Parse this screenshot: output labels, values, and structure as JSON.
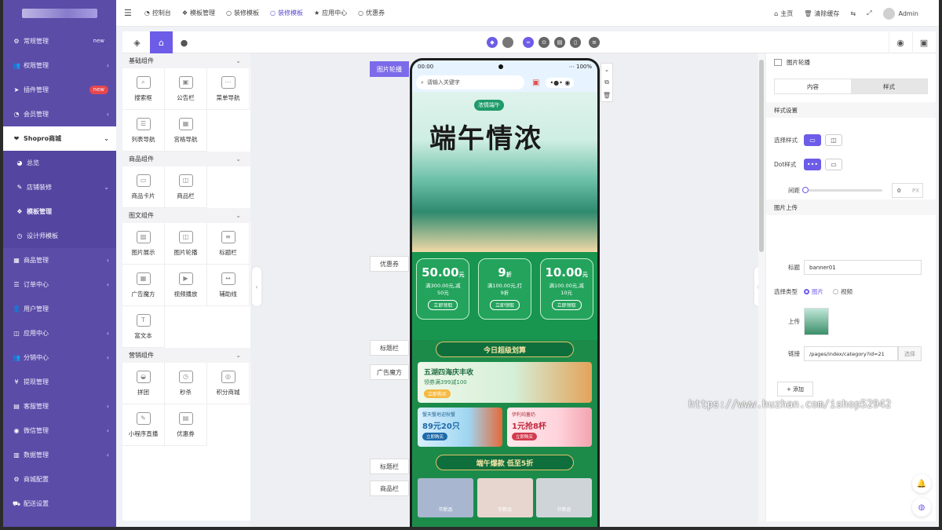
{
  "topbar": {
    "items": [
      {
        "icon": "dashboard-icon",
        "glyph": "◔",
        "label": "控制台"
      },
      {
        "icon": "cubes-icon",
        "glyph": "❖",
        "label": "模板管理"
      },
      {
        "icon": "circle-icon",
        "glyph": "○",
        "label": "装修模板"
      },
      {
        "icon": "circle-icon",
        "glyph": "○",
        "label": "装修模板"
      },
      {
        "icon": "star-icon",
        "glyph": "★",
        "label": "应用中心"
      },
      {
        "icon": "circle-icon",
        "glyph": "○",
        "label": "优惠券"
      }
    ],
    "active_index": 3,
    "right": {
      "home": "主页",
      "clear_cache": "清除缓存",
      "user": "Admin"
    }
  },
  "sidebar": {
    "items": [
      {
        "label": "常规管理",
        "badge": "new",
        "badge_color": "#5b4ca8"
      },
      {
        "label": "权限管理",
        "arrow": "‹"
      },
      {
        "label": "插件管理",
        "badge": "new",
        "badge_color": "#e5484d"
      },
      {
        "label": "会员管理",
        "arrow": "‹"
      },
      {
        "label": "Shopro商城",
        "arrow": "⌄",
        "active": true
      },
      {
        "label": "总览",
        "sub": true
      },
      {
        "label": "店铺装修",
        "arrow": "⌄",
        "sub": true
      },
      {
        "label": "模板管理",
        "sub": true,
        "bold": true
      },
      {
        "label": "设计师模板",
        "sub": true
      },
      {
        "label": "商品管理",
        "arrow": "‹"
      },
      {
        "label": "订单中心",
        "arrow": "‹"
      },
      {
        "label": "用户管理"
      },
      {
        "label": "应用中心",
        "arrow": "‹"
      },
      {
        "label": "分销中心",
        "arrow": "‹"
      },
      {
        "label": "提现管理"
      },
      {
        "label": "客服管理",
        "arrow": "‹"
      },
      {
        "label": "微信管理",
        "arrow": "‹"
      },
      {
        "label": "数据管理",
        "arrow": "‹"
      },
      {
        "label": "商城配置"
      },
      {
        "label": "配送设置"
      }
    ]
  },
  "components": {
    "groups": [
      {
        "title": "基础组件",
        "items": [
          "搜索框",
          "公告栏",
          "菜单导航",
          "列表导航",
          "宫格导航"
        ]
      },
      {
        "title": "商品组件",
        "items": [
          "商品卡片",
          "商品栏"
        ]
      },
      {
        "title": "图文组件",
        "items": [
          "图片展示",
          "图片轮播",
          "标题栏",
          "广告魔方",
          "视频播放",
          "辅助线",
          "富文本"
        ]
      },
      {
        "title": "营销组件",
        "items": [
          "拼团",
          "秒杀",
          "积分商城",
          "小程序直播",
          "优惠券"
        ]
      }
    ]
  },
  "canvas": {
    "chips": {
      "banner": "图片轮播",
      "coupon": "优惠券",
      "title1": "标题栏",
      "ad": "广告魔方",
      "title2": "标题栏",
      "goods": "商品栏"
    },
    "phone": {
      "time": "00:00",
      "battery": "100%",
      "search_placeholder": "请输入关键字",
      "banner_title": "端午情浓",
      "banner_seal": "浓情端午",
      "coupons": [
        {
          "value": "50.00",
          "unit": "元",
          "desc": "满300.00元,减",
          "desc2": "50元",
          "btn": "立即领取"
        },
        {
          "value": "9",
          "unit": "折",
          "desc": "满100.00元,打",
          "desc2": "9折",
          "btn": "立即领取"
        },
        {
          "value": "10.00",
          "unit": "元",
          "desc": "满100.00元,减",
          "desc2": "10元",
          "btn": "立即领取"
        }
      ],
      "ribbon1": "今日超级划算",
      "promo": {
        "title": "五湖四海庆丰收",
        "sub": "领券满399减100",
        "btn": "立即购买"
      },
      "duo": [
        {
          "sub": "蟹天蟹地迎秋蟹",
          "price": "89元20只",
          "btn": "立即购买"
        },
        {
          "sub": "伊利纯蓄奶",
          "price": "1元抢8杯",
          "btn": "立即购买"
        }
      ],
      "ribbon2": "端午爆款 低至5折",
      "prods": [
        "节新品",
        "节新品",
        "节新品"
      ]
    }
  },
  "props": {
    "header": "图片轮播",
    "tabs": [
      "内容",
      "样式"
    ],
    "style_section": "样式设置",
    "select_style": "选择样式",
    "dot_style": "Dot样式",
    "spacing": "间距",
    "spacing_value": "0",
    "spacing_unit": "PX",
    "upload_section": "图片上传",
    "title_label": "标题",
    "title_value": "banner01",
    "type_label": "选择类型",
    "type_image": "图片",
    "type_video": "视频",
    "upload_label": "上传",
    "link_label": "链接",
    "link_value": "/pages/index/category?id=21",
    "link_btn": "选择",
    "add_btn": "+ 添加"
  },
  "watermark": "https://www.huzhan.com/ishop52942"
}
